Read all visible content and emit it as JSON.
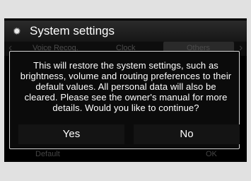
{
  "window": {
    "title": "System settings",
    "icon": "gear-icon"
  },
  "tabs": [
    {
      "label": "Voice Recog."
    },
    {
      "label": "Clock"
    },
    {
      "label": "Others"
    }
  ],
  "bottom": {
    "left_label": "Default",
    "right_label": "OK"
  },
  "dialog": {
    "message": "This will restore the system settings, such as brightness, volume and routing preferences to their default values. All personal data will also be cleared. Please see the owner's manual for more details. Would you like to continue?",
    "yes_label": "Yes",
    "no_label": "No"
  }
}
